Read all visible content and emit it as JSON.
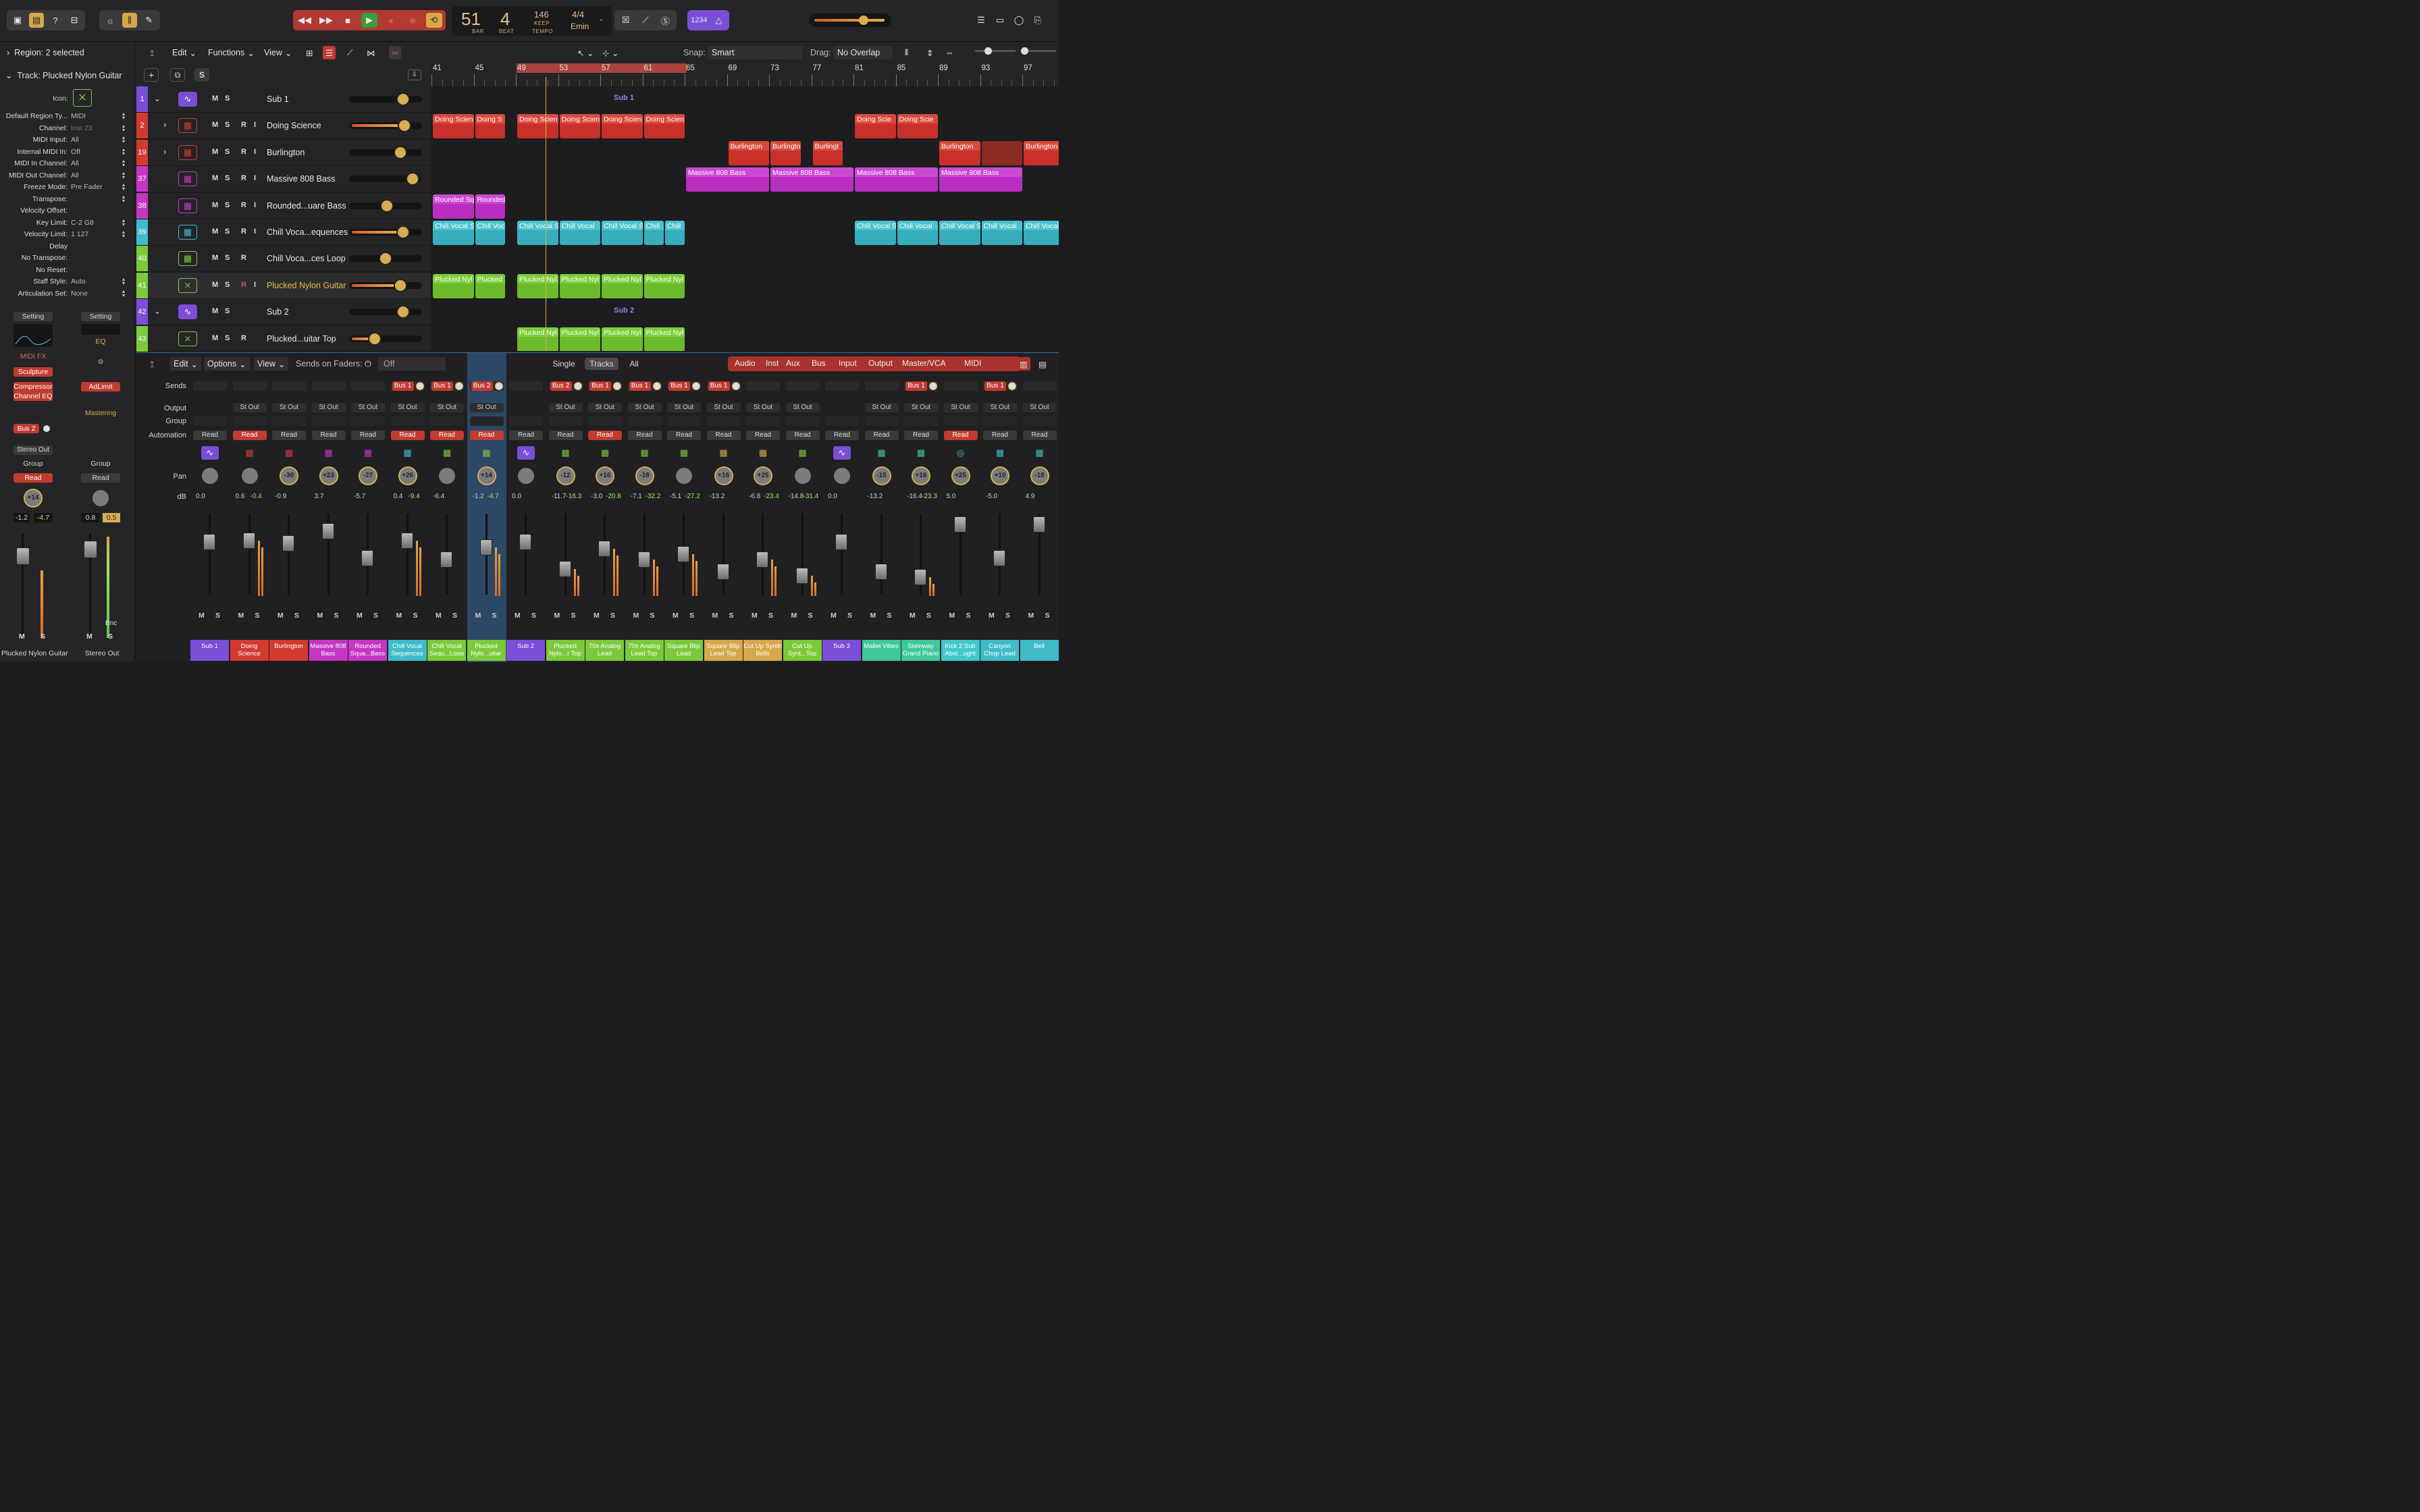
{
  "control_bar": {
    "lcd": {
      "bar": "51",
      "bar_label": "BAR",
      "beat": "4",
      "beat_label": "BEAT",
      "tempo": "146",
      "tempo_mode": "KEEP",
      "tempo_label": "TEMPO",
      "time_sig": "4/4",
      "key": "Emin"
    },
    "count_in": "1234"
  },
  "inspector": {
    "region_header": "Region: 2 selected",
    "track_header": "Track: Plucked Nylon Guitar",
    "icon_label": "Icon:",
    "fields": [
      {
        "label": "Default Region Ty...",
        "value": "MIDI"
      },
      {
        "label": "Channel:",
        "value": "Inst 23"
      },
      {
        "label": "MIDI Input:",
        "value": "All"
      },
      {
        "label": "Internal MIDI In:",
        "value": "Off"
      },
      {
        "label": "MIDI In Channel:",
        "value": "All"
      },
      {
        "label": "MIDI Out Channel:",
        "value": "All"
      },
      {
        "label": "Freeze Mode:",
        "value": "Pre Fader"
      },
      {
        "label": "Transpose:",
        "value": ""
      },
      {
        "label": "Velocity Offset:",
        "value": ""
      },
      {
        "label": "Key Limit:",
        "value": "C-2  G8"
      },
      {
        "label": "Velocity Limit:",
        "value": "1  127"
      },
      {
        "label": "Delay",
        "value": ""
      },
      {
        "label": "No Transpose:",
        "value": ""
      },
      {
        "label": "No Reset:",
        "value": ""
      },
      {
        "label": "Staff Style:",
        "value": "Auto"
      },
      {
        "label": "Articulation Set:",
        "value": "None"
      }
    ],
    "strips": [
      {
        "setting": "Setting",
        "plugin_a": "MIDI FX",
        "plugin_b": "Sculpture",
        "plugin_c": "Compressor",
        "plugin_d": "Channel EQ",
        "send": "Bus 2",
        "output": "Stereo Out",
        "group": "Group",
        "automation": "Read",
        "pan": "+14",
        "db_a": "-1.2",
        "db_b": "-4.7",
        "m": "M",
        "s": "S",
        "name": "Plucked Nylon Guitar"
      },
      {
        "setting": "Setting",
        "plugin_a": "EQ",
        "plugin_b": "AdLimit",
        "plugin_c": "Mastering",
        "group": "Group",
        "automation": "Read",
        "db_a": "0.8",
        "db_b": "0.5",
        "bnc": "Bnc",
        "m": "M",
        "s": "S",
        "name": "Stereo Out"
      }
    ]
  },
  "tracks_toolbar": {
    "edit": "Edit",
    "functions": "Functions",
    "view": "View",
    "snap_label": "Snap:",
    "snap_value": "Smart",
    "drag_label": "Drag:",
    "drag_value": "No Overlap"
  },
  "ruler": [
    "41",
    "45",
    "49",
    "53",
    "57",
    "61",
    "65",
    "69",
    "73",
    "77",
    "81",
    "85",
    "89",
    "93",
    "97"
  ],
  "tracks": [
    {
      "num": "1",
      "name": "Sub 1",
      "color": "#7a4fd6",
      "icon": "waveform-icon",
      "summary": "Sub 1",
      "rri": false
    },
    {
      "num": "2",
      "name": "Doing Science",
      "color": "#d23a30",
      "icon": "drum-machine-icon",
      "rri": true
    },
    {
      "num": "19",
      "name": "Burlington",
      "color": "#d23a30",
      "icon": "drum-machine-icon",
      "rri": true
    },
    {
      "num": "37",
      "name": "Massive 808 Bass",
      "color": "#c636c4",
      "icon": "keyboard-icon",
      "rri": true
    },
    {
      "num": "38",
      "name": "Rounded...uare Bass",
      "color": "#c636c4",
      "icon": "keyboard-icon",
      "rri": true
    },
    {
      "num": "39",
      "name": "Chill Voca...equences",
      "color": "#3fbcc9",
      "icon": "keyboard-icon",
      "rri": true
    },
    {
      "num": "40",
      "name": "Chill Voca...ces Loop",
      "color": "#7cc93a",
      "icon": "keyboard-icon",
      "rri": false
    },
    {
      "num": "41",
      "name": "Plucked Nylon Guitar",
      "color": "#7cc93a",
      "icon": "guitar-stand-icon",
      "rri": true,
      "selected": true
    },
    {
      "num": "42",
      "name": "Sub 2",
      "color": "#7a4fd6",
      "icon": "waveform-icon",
      "summary": "Sub 2",
      "rri": false
    },
    {
      "num": "43",
      "name": "Plucked...uitar Top",
      "color": "#7cc93a",
      "icon": "guitar-stand-icon",
      "rri": false
    }
  ],
  "regions": {
    "doing": "Doing Scien",
    "doing_s": "Doing S",
    "doing_scie": "Doing Scie",
    "burlington": "Burlington",
    "burlingto": "Burlingto",
    "burlingt": "Burlingt",
    "massive": "Massive 808 Bass",
    "rounded_sq": "Rounded Sq",
    "rounded": "Rounded",
    "chill_s": "Chill Vocal S",
    "chill_voc": "Chill Voc",
    "chill_vocal": "Chill Vocal",
    "chill": "Chill",
    "plucked_nyl": "Plucked Nyl",
    "plucked": "Plucked"
  },
  "mixer_toolbar": {
    "edit": "Edit",
    "options": "Options",
    "view": "View",
    "sends_on_faders": "Sends on Faders:",
    "sends_value": "Off",
    "single": "Single",
    "tracks": "Tracks",
    "all": "All",
    "filters": [
      "Audio",
      "Inst",
      "Aux",
      "Bus",
      "Input",
      "Output",
      "Master/VCA",
      "MIDI"
    ]
  },
  "mixer_labels": {
    "sends": "Sends",
    "output": "Output",
    "group": "Group",
    "automation": "Automation",
    "pan": "Pan",
    "db": "dB"
  },
  "channels": [
    {
      "name": "Sub 1",
      "color": "#7a4fd6",
      "bus": "",
      "out": "",
      "auto": "Read",
      "red": false,
      "pan": "",
      "db_a": "0.0",
      "db_b": "",
      "cap": 30
    },
    {
      "name": "Doing Science",
      "color": "#d23a30",
      "bus": "",
      "out": "St Out",
      "auto": "Read",
      "red": true,
      "pan": "",
      "db_a": "0.6",
      "db_b": "-0.4",
      "cap": 28
    },
    {
      "name": "Burlington",
      "color": "#d23a30",
      "bus": "",
      "out": "St Out",
      "auto": "Read",
      "red": false,
      "pan": "-30",
      "db_a": "-0.9",
      "db_b": "",
      "cap": 32
    },
    {
      "name": "Massive 808 Bass",
      "color": "#c636c4",
      "bus": "",
      "out": "St Out",
      "auto": "Read",
      "red": false,
      "pan": "+23",
      "db_a": "3.7",
      "db_b": "",
      "cap": 14
    },
    {
      "name": "Rounded Squa...Bass",
      "color": "#c636c4",
      "bus": "",
      "out": "St Out",
      "auto": "Read",
      "red": false,
      "pan": "-27",
      "db_a": "-5.7",
      "db_b": "",
      "cap": 54
    },
    {
      "name": "Chill Vocal Sequences",
      "color": "#3fbcc9",
      "bus": "Bus 1",
      "out": "St Out",
      "auto": "Read",
      "red": true,
      "pan": "+26",
      "db_a": "0.4",
      "db_b": "-9.4",
      "cap": 28
    },
    {
      "name": "Chill Vocal Sequ...Loop",
      "color": "#7cc93a",
      "bus": "Bus 1",
      "out": "St Out",
      "auto": "Read",
      "red": true,
      "pan": "",
      "db_a": "-6.4",
      "db_b": "",
      "cap": 56
    },
    {
      "name": "Plucked Nylo...uitar",
      "color": "#7cc93a",
      "bus": "Bus 2",
      "out": "St Out",
      "auto": "Read",
      "red": true,
      "pan": "+14",
      "db_a": "-1.2",
      "db_b": "-4.7",
      "cap": 38,
      "selected": true
    },
    {
      "name": "Sub 2",
      "color": "#7a4fd6",
      "bus": "",
      "out": "",
      "auto": "Read",
      "red": false,
      "pan": "",
      "db_a": "0.0",
      "db_b": "",
      "cap": 30
    },
    {
      "name": "Plucked Nylo...r Top",
      "color": "#7cc93a",
      "bus": "Bus 2",
      "out": "St Out",
      "auto": "Read",
      "red": false,
      "pan": "-12",
      "db_a": "-11.7",
      "db_b": "-16.3",
      "cap": 70
    },
    {
      "name": "70s Analog Lead",
      "color": "#7cc93a",
      "bus": "Bus 1",
      "out": "St Out",
      "auto": "Read",
      "red": true,
      "pan": "+16",
      "db_a": "-3.0",
      "db_b": "-20.8",
      "cap": 40
    },
    {
      "name": "70s Analog Lead Top",
      "color": "#7cc93a",
      "bus": "Bus 1",
      "out": "St Out",
      "auto": "Read",
      "red": false,
      "pan": "-18",
      "db_a": "-7.1",
      "db_b": "-32.2",
      "cap": 56
    },
    {
      "name": "Square Blip Lead",
      "color": "#7cc93a",
      "bus": "Bus 1",
      "out": "St Out",
      "auto": "Read",
      "red": false,
      "pan": "",
      "db_a": "-5.1",
      "db_b": "-27.2",
      "cap": 48
    },
    {
      "name": "Square Blip Lead Top",
      "color": "#d7a84a",
      "bus": "Bus 1",
      "out": "St Out",
      "auto": "Read",
      "red": false,
      "pan": "+16",
      "db_a": "-13.2",
      "db_b": "",
      "cap": 74
    },
    {
      "name": "Cut Up Synth Bells",
      "color": "#d7a84a",
      "bus": "",
      "out": "St Out",
      "auto": "Read",
      "red": false,
      "pan": "+25",
      "db_a": "-6.8",
      "db_b": "-23.4",
      "cap": 56
    },
    {
      "name": "Cut Up Synt...Top",
      "color": "#7cc93a",
      "bus": "",
      "out": "St Out",
      "auto": "Read",
      "red": false,
      "pan": "",
      "db_a": "-14.8",
      "db_b": "-31.4",
      "cap": 80
    },
    {
      "name": "Sub 3",
      "color": "#7a4fd6",
      "bus": "",
      "out": "",
      "auto": "Read",
      "red": false,
      "pan": "",
      "db_a": "0.0",
      "db_b": "",
      "cap": 30
    },
    {
      "name": "Mallet Vibes",
      "color": "#3fc99a",
      "bus": "",
      "out": "St Out",
      "auto": "Read",
      "red": false,
      "pan": "-15",
      "db_a": "-13.2",
      "db_b": "",
      "cap": 74
    },
    {
      "name": "Steinway Grand Piano",
      "color": "#3fc99a",
      "bus": "Bus 1",
      "out": "St Out",
      "auto": "Read",
      "red": false,
      "pan": "+16",
      "db_a": "-16.4",
      "db_b": "-23.3",
      "cap": 82
    },
    {
      "name": "Kick 2 Sub Abst...ught",
      "color": "#3fc9c9",
      "bus": "",
      "out": "St Out",
      "auto": "Read",
      "red": true,
      "pan": "+25",
      "db_a": "5.0",
      "db_b": "",
      "cap": 4
    },
    {
      "name": "Canyon Chop Lead",
      "color": "#3fbcc9",
      "bus": "Bus 1",
      "out": "St Out",
      "auto": "Read",
      "red": false,
      "pan": "+10",
      "db_a": "-5.0",
      "db_b": "",
      "cap": 54
    },
    {
      "name": "Bell",
      "color": "#3fbcc9",
      "bus": "",
      "out": "St Out",
      "auto": "Read",
      "red": false,
      "pan": "-18",
      "db_a": "4.9",
      "db_b": "",
      "cap": 4
    }
  ],
  "colors": {
    "accent": "#d7a84a",
    "record": "#c23a30",
    "play": "#3c9a3c",
    "selected_strip": "#2c4866"
  }
}
